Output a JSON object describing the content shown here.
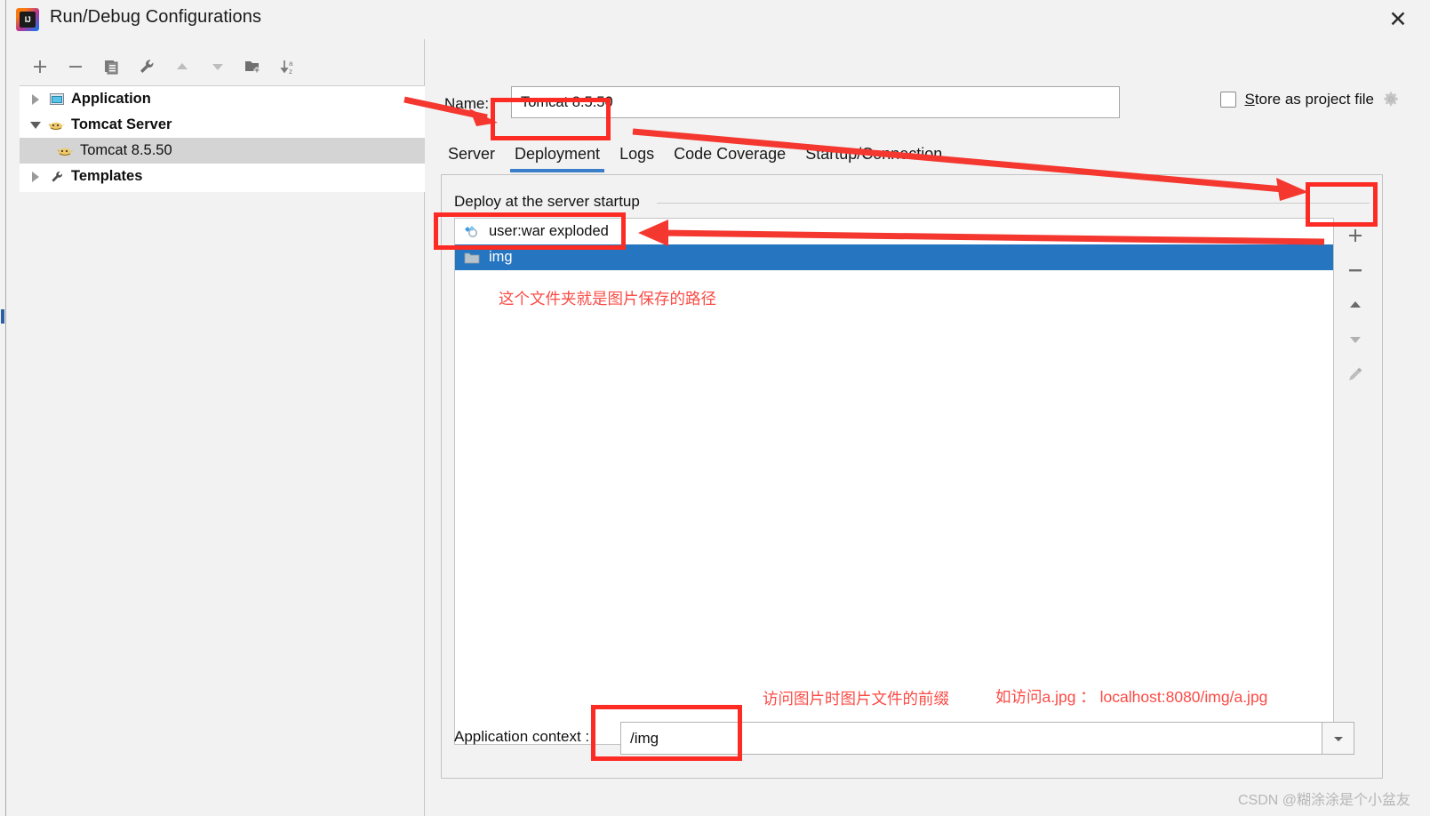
{
  "window": {
    "title": "Run/Debug Configurations",
    "logo_icon": "intellij-idea-logo",
    "close_icon": "close-icon"
  },
  "left_panel": {
    "toolbar": [
      {
        "name": "add-configuration",
        "icon": "plus-icon"
      },
      {
        "name": "remove-configuration",
        "icon": "minus-icon"
      },
      {
        "name": "copy-configuration",
        "icon": "copy-icon"
      },
      {
        "name": "edit-templates",
        "icon": "wrench-icon"
      },
      {
        "name": "move-up",
        "icon": "arrow-up-icon"
      },
      {
        "name": "move-down",
        "icon": "arrow-down-icon"
      },
      {
        "name": "new-folder",
        "icon": "new-folder-icon"
      },
      {
        "name": "sort-alphabetically",
        "icon": "sort-az-icon"
      }
    ],
    "tree": [
      {
        "label": "Application",
        "icon": "application-icon",
        "twisty": "collapsed",
        "bold": true,
        "depth": 0,
        "selected": false
      },
      {
        "label": "Tomcat Server",
        "icon": "tomcat-icon",
        "twisty": "expanded",
        "bold": true,
        "depth": 0,
        "selected": false
      },
      {
        "label": "Tomcat 8.5.50",
        "icon": "tomcat-icon",
        "twisty": "none",
        "bold": false,
        "depth": 1,
        "selected": true
      },
      {
        "label": "Templates",
        "icon": "wrench-icon",
        "twisty": "collapsed",
        "bold": true,
        "depth": 0,
        "selected": false
      }
    ]
  },
  "form": {
    "name_label_prefix": "N",
    "name_label_rest": "ame:",
    "name_value": "Tomcat 8.5.50",
    "store_as_project_file": {
      "label_prefix": "S",
      "label_rest": "tore as project file",
      "checked": false,
      "gear_icon": "gear-icon"
    }
  },
  "tabs": [
    {
      "label": "Server",
      "active": false
    },
    {
      "label": "Deployment",
      "active": true
    },
    {
      "label": "Logs",
      "active": false
    },
    {
      "label": "Code Coverage",
      "active": false
    },
    {
      "label": "Startup/Connection",
      "active": false
    }
  ],
  "deployment": {
    "section_title": "Deploy at the server startup",
    "items": [
      {
        "label": "user:war exploded",
        "icon": "artifact-icon",
        "selected": false
      },
      {
        "label": "img",
        "icon": "folder-icon",
        "selected": true
      }
    ],
    "side_tools": [
      {
        "name": "add-artifact",
        "icon": "plus-icon"
      },
      {
        "name": "remove-artifact",
        "icon": "minus-icon"
      },
      {
        "name": "move-up",
        "icon": "arrow-up-icon"
      },
      {
        "name": "move-down",
        "icon": "arrow-down-icon"
      },
      {
        "name": "edit-artifact",
        "icon": "pencil-icon"
      }
    ],
    "context_label": "Application context :",
    "context_value": "/img",
    "context_dropdown_icon": "chevron-down-icon"
  },
  "annotations": {
    "folder_note": "这个文件夹就是图片保存的路径",
    "prefix_note": "访问图片时图片文件的前缀",
    "url_note": "如访问a.jpg ： localhost:8080/img/a.jpg",
    "accent_color": "#fc2c25"
  },
  "watermark": "CSDN @糊涂涂是个小盆友"
}
